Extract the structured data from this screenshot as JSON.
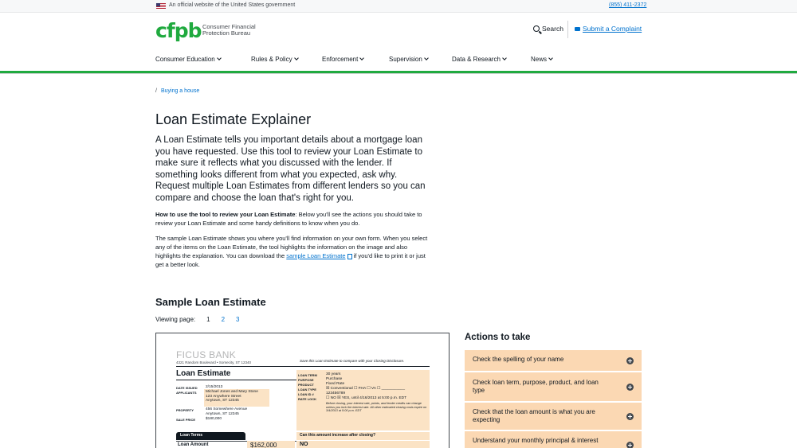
{
  "gov_banner": {
    "text": "An official website of the United States government",
    "phone": "(855) 411-2372"
  },
  "header": {
    "logo_mark": "cfpb",
    "logo_text": "Consumer Financial Protection Bureau",
    "search_label": "Search",
    "complaint_label": "Submit a Complaint"
  },
  "nav": {
    "items": [
      {
        "label": "Consumer Education"
      },
      {
        "label": "Rules & Policy"
      },
      {
        "label": "Enforcement"
      },
      {
        "label": "Supervision"
      },
      {
        "label": "Data & Research"
      },
      {
        "label": "News"
      }
    ]
  },
  "breadcrumb": {
    "slash": "/",
    "link": "Buying a house"
  },
  "main": {
    "title": "Loan Estimate Explainer",
    "lead": "A Loan Estimate tells you important details about a mortgage loan you have requested. Use this tool to review your Loan Estimate to make sure it reflects what you discussed with the lender. If something looks different from what you expected, ask why. Request multiple Loan Estimates from different lenders so you can compare and choose the loan that's right for you.",
    "howto_bold": "How to use the tool to review your Loan Estimate",
    "howto_rest": ": Below you'll see the actions you should take to review your Loan Estimate and some handy definitions to know when you do.",
    "sample_text_1": "The sample Loan Estimate shows you where you'll find information on your own form. When you select any of the items on the Loan Estimate, the tool highlights the information on the image and also highlights the explanation. You can download the ",
    "sample_link": "sample Loan Estimate",
    "sample_text_2": " if you'd like to print it or just get a better look."
  },
  "sample": {
    "title": "Sample Loan Estimate",
    "viewing_label": "Viewing page:",
    "pages": [
      "1",
      "2",
      "3"
    ]
  },
  "form": {
    "bank": "FICUS BANK",
    "address": "4321 Random Boulevard • Somecity, ST 12340",
    "save_note": "Save this Loan Estimate to compare with your Closing Disclosure.",
    "title": "Loan Estimate",
    "date_issued_label": "DATE ISSUED",
    "date_issued": "2/15/2013",
    "applicants_label": "APPLICANTS",
    "applicants": [
      "Michael Jones and Mary Stone",
      "123 Anywhere Street",
      "Anytown, ST 12345"
    ],
    "property_label": "PROPERTY",
    "property": [
      "456 Somewhere Avenue",
      "Anytown, ST 12345"
    ],
    "sale_price_label": "SALE PRICE",
    "sale_price": "$180,000",
    "loan_term_label": "LOAN TERM",
    "loan_term": "30 years",
    "purpose_label": "PURPOSE",
    "purpose": "Purchase",
    "product_label": "PRODUCT",
    "product": "Fixed Rate",
    "loan_type_label": "LOAN TYPE",
    "loan_type": "☒ Conventional  ☐ FHA  ☐ VA  ☐ ___________",
    "loan_id_label": "LOAN ID #",
    "loan_id": "123456789",
    "rate_lock_label": "RATE LOCK",
    "rate_lock": "☐ NO  ☒ YES, until 4/16/2013 at 5:00 p.m. EDT",
    "rate_lock_note": "Before closing, your interest rate, points, and lender credits can change unless you lock the interest rate. All other estimated closing costs expire on 3/4/2013 at 5:00 p.m. EDT",
    "loan_terms_header": "Loan Terms",
    "question_header": "Can this amount increase after closing?",
    "loan_amount_label": "Loan Amount",
    "loan_amount": "$162,000",
    "loan_amount_answer": "NO"
  },
  "actions": {
    "title": "Actions to take",
    "items": [
      {
        "label": "Check the spelling of your name"
      },
      {
        "label": "Check loan term, purpose, product, and loan type"
      },
      {
        "label": "Check that the loan amount is what you are expecting"
      },
      {
        "label": "Understand your monthly principal & interest"
      }
    ]
  },
  "colors": {
    "brand_green": "#20aa3f",
    "link_blue": "#0072ce",
    "highlight_orange": "#fbd8b3"
  }
}
